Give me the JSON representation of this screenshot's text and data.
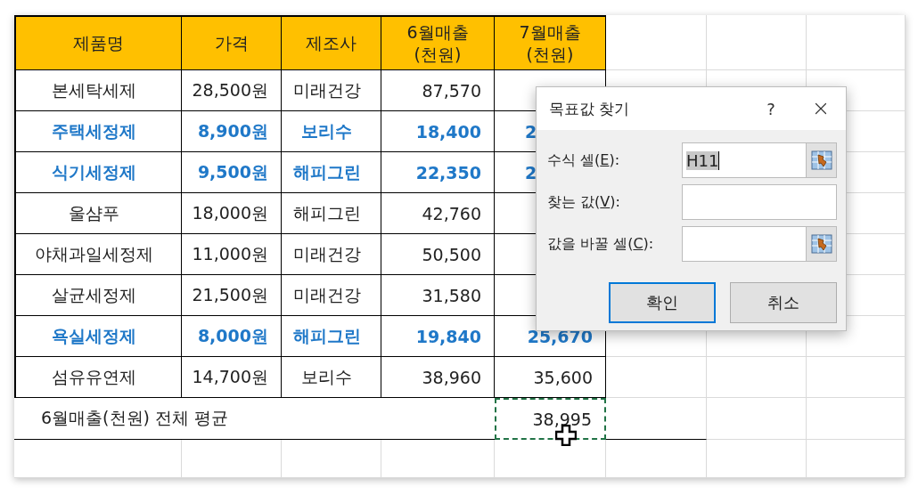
{
  "sheet": {
    "columns": [
      "제품명",
      "가격",
      "제조사",
      "6월매출\n(천원)",
      "7월매출\n(천원)"
    ],
    "rows": [
      {
        "name": "본세탁세제",
        "price": "28,500원",
        "maker": "미래건강",
        "june": "87,570",
        "emphasized": false
      },
      {
        "name": "주택세정제",
        "price": "8,900원",
        "maker": "보리수",
        "june": "18,400",
        "july": "2",
        "july_cut": true,
        "emphasized": true
      },
      {
        "name": "식기세정제",
        "price": "9,500원",
        "maker": "해피그린",
        "june": "22,350",
        "july": "2",
        "july_cut": true,
        "emphasized": true
      },
      {
        "name": "울샴푸",
        "price": "18,000원",
        "maker": "해피그린",
        "june": "42,760",
        "emphasized": false
      },
      {
        "name": "야채과일세정제",
        "price": "11,000원",
        "maker": "미래건강",
        "june": "50,500",
        "emphasized": false
      },
      {
        "name": "살균세정제",
        "price": "21,500원",
        "maker": "미래건강",
        "june": "31,580",
        "emphasized": false
      },
      {
        "name": "욕실세정제",
        "price": "8,000원",
        "maker": "해피그린",
        "june": "19,840",
        "july": "25,670",
        "july_cut": false,
        "emphasized": true
      },
      {
        "name": "섬유유연제",
        "price": "14,700원",
        "maker": "보리수",
        "june": "38,960",
        "july": "35,600",
        "july_cut": false,
        "emphasized": false
      }
    ],
    "average": {
      "label": "6월매출(천원) 전체 평균",
      "value": "38,995",
      "selected": true
    }
  },
  "dialog": {
    "title": "목표값 찾기",
    "help": "?",
    "fields": [
      {
        "label": "수식 셀(",
        "key": "E",
        "suffix": "):",
        "value": "H11",
        "value_selected": true,
        "picker": true
      },
      {
        "label": "찾는 값(",
        "key": "V",
        "suffix": "):",
        "picker": false
      },
      {
        "label": "값을 바꿀 셀(",
        "key": "C",
        "suffix": "):",
        "picker": true
      }
    ],
    "buttons": [
      {
        "label": "확인",
        "default": true
      },
      {
        "label": "취소",
        "default": false
      }
    ]
  }
}
